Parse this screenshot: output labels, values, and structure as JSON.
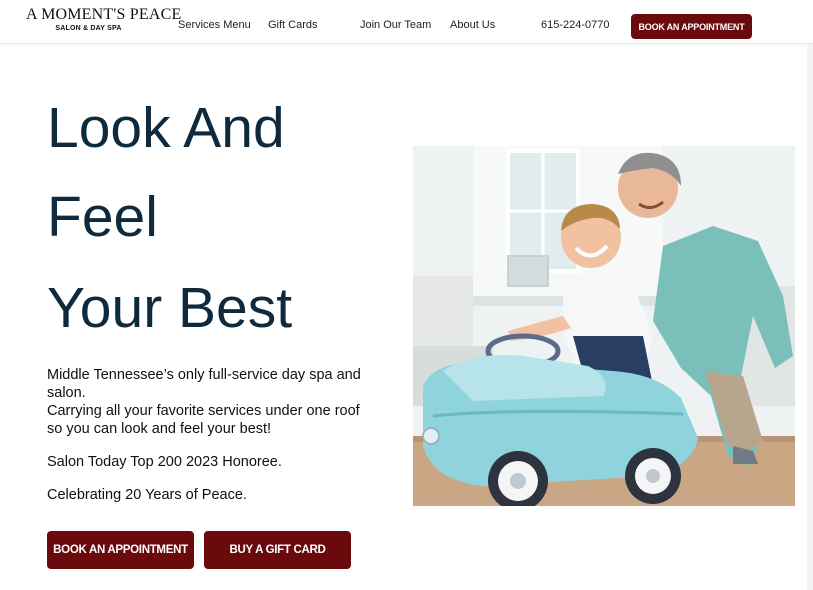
{
  "header": {
    "logo_main": "A MOMENT'S PEACE",
    "logo_sub": "SALON & DAY SPA",
    "nav": [
      {
        "label": "Services Menu"
      },
      {
        "label": "Gift Cards"
      },
      {
        "label": "Join Our Team"
      },
      {
        "label": "About Us"
      }
    ],
    "phone": "615-224-0770",
    "cta_label": "BOOK AN APPOINTMENT"
  },
  "hero": {
    "headline_lines": [
      "Look And",
      "Feel",
      "Your Best"
    ],
    "paragraphs": [
      "Middle Tennessee’s only full-service day spa and salon.",
      "Carrying all your favorite services under one roof so you can look and feel your best!",
      "Salon Today Top 200 2023 Honoree.",
      "Celebrating 20 Years of Peace."
    ],
    "buttons": {
      "book_label": "BOOK AN APPOINTMENT",
      "gift_label": "BUY A GIFT CARD"
    }
  },
  "colors": {
    "brand_button": "#6b0a0c",
    "headline": "#0f2a3d"
  }
}
